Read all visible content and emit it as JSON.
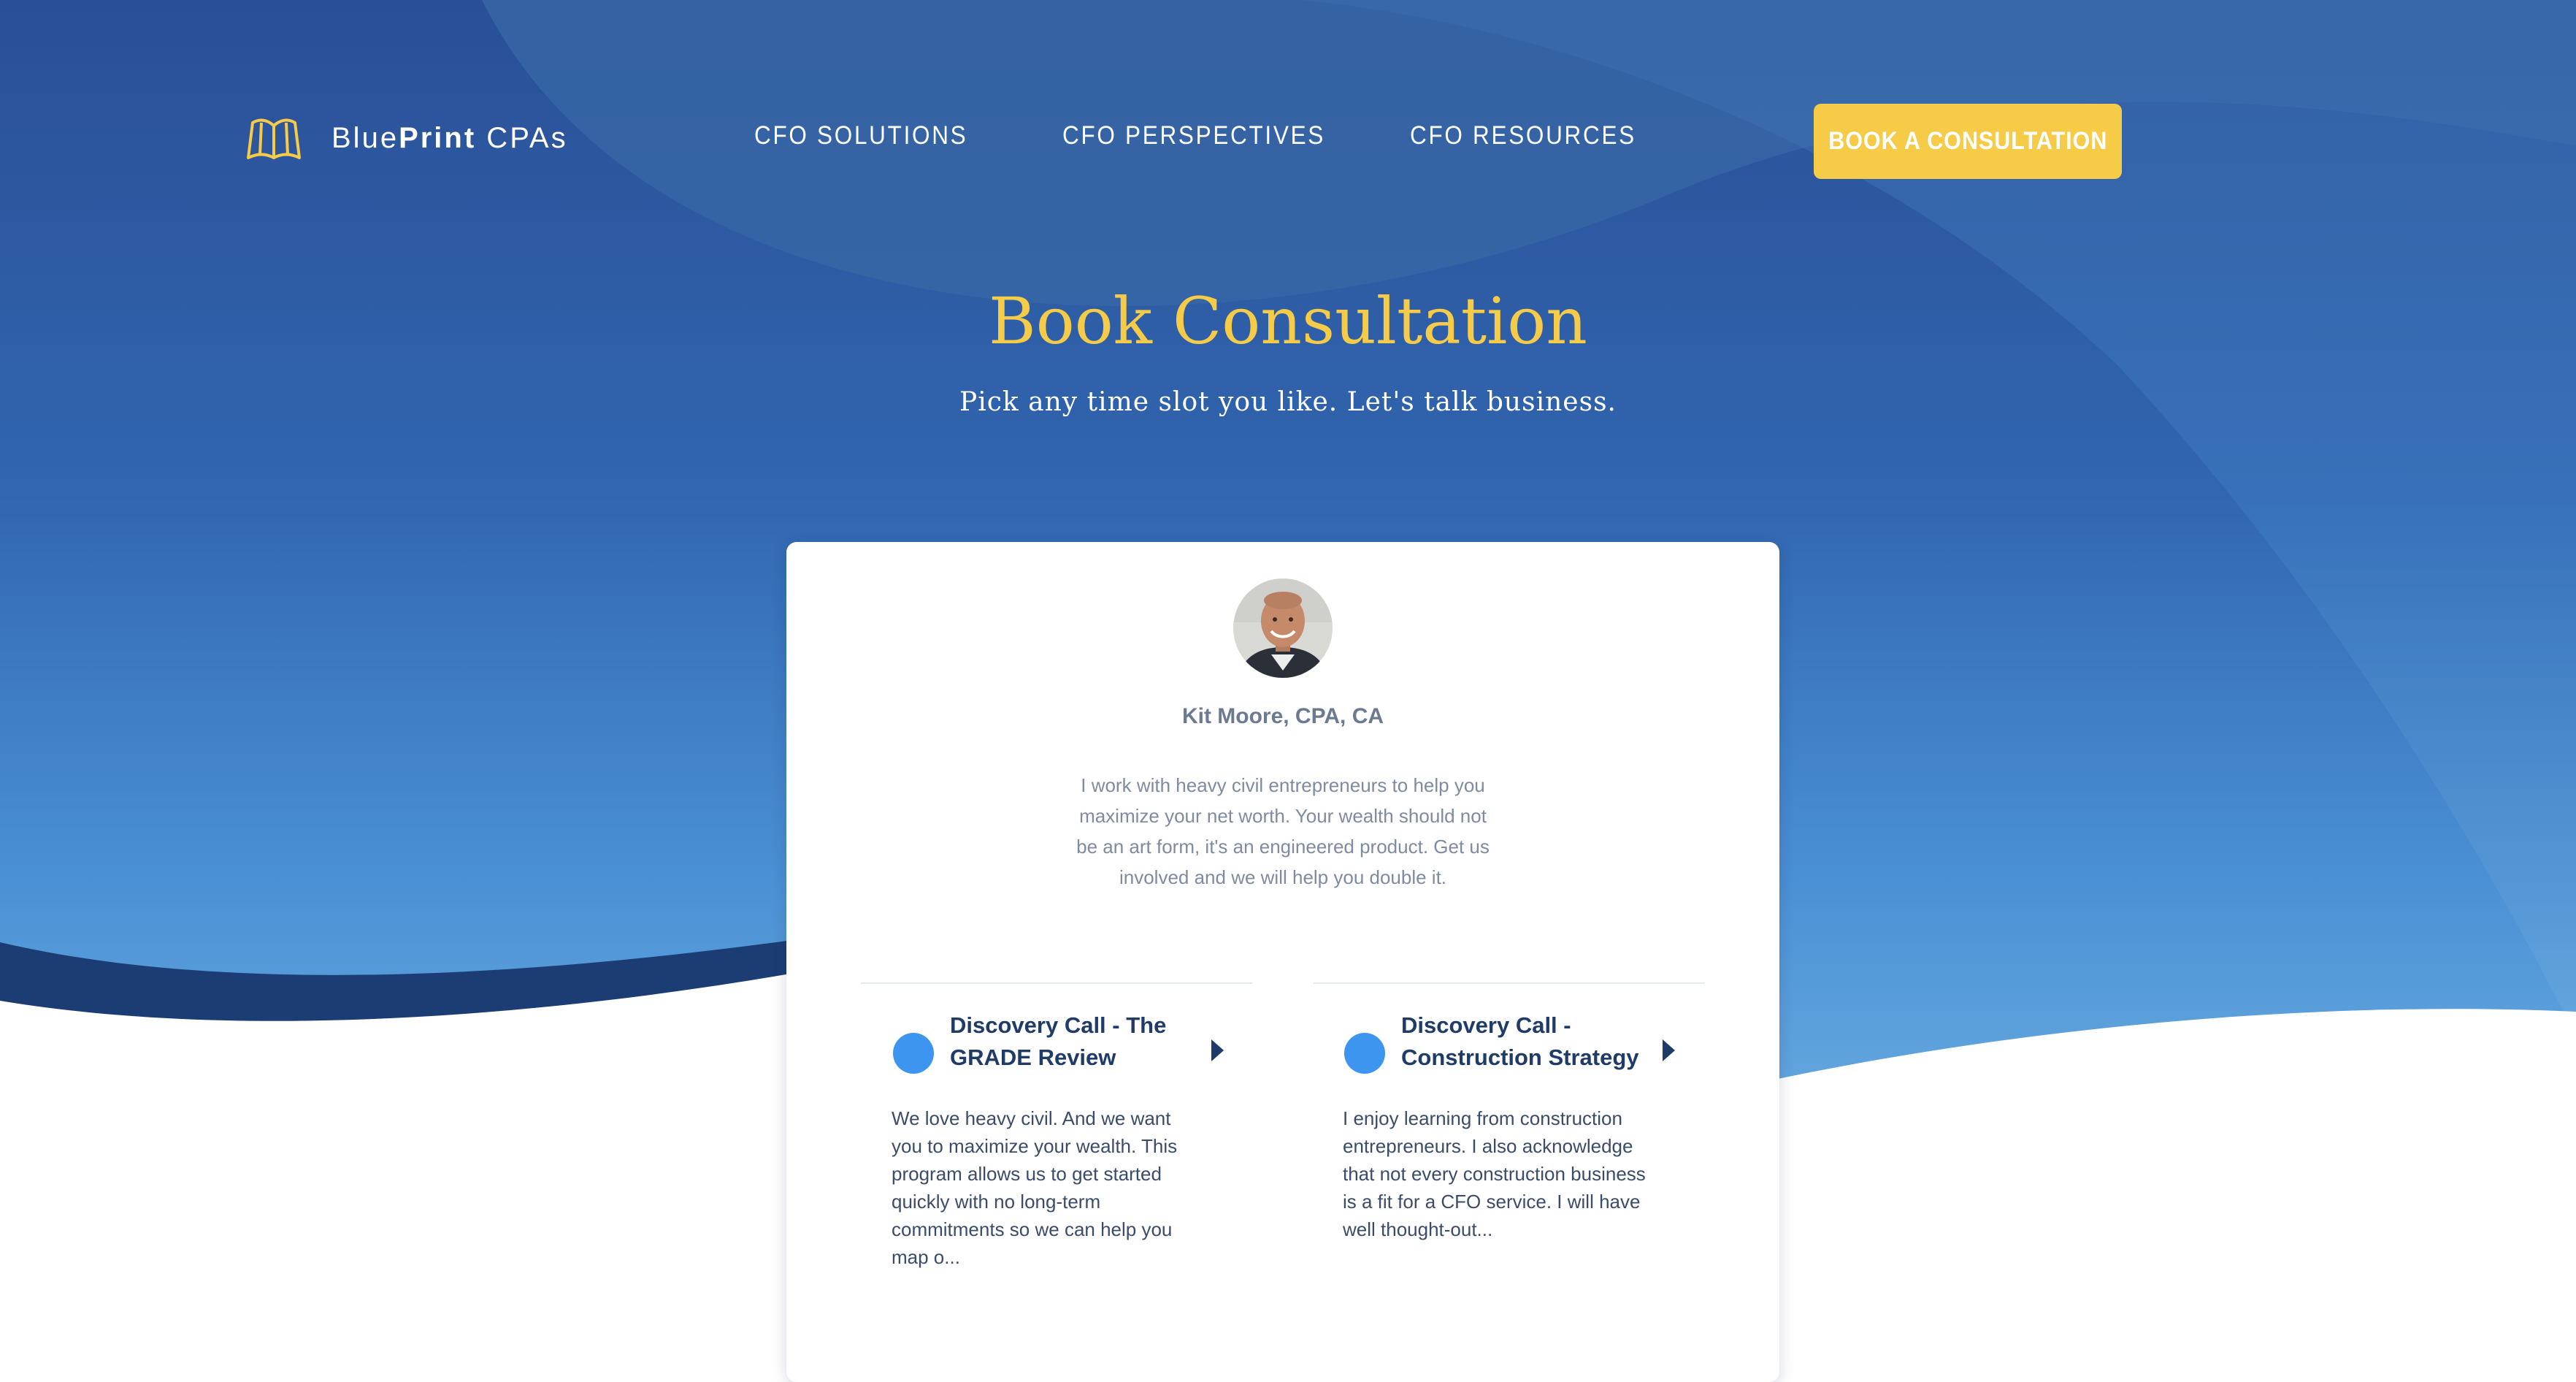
{
  "brand": {
    "name_part1": "Blue",
    "name_part2": "Print",
    "name_part3": " CPAs",
    "logo_icon": "open-book-icon"
  },
  "nav": {
    "links": [
      "CFO SOLUTIONS",
      "CFO PERSPECTIVES",
      "CFO RESOURCES"
    ],
    "cta_label": "BOOK A CONSULTATION"
  },
  "hero": {
    "title": "Book Consultation",
    "subtitle": "Pick any time slot you like. Let's talk business."
  },
  "host": {
    "name": "Kit Moore, CPA, CA",
    "bio": "I work with heavy civil entrepreneurs to help you maximize your net worth.   Your wealth should not be an art form, it's an engineered product. Get us involved and we will help you double it."
  },
  "events": [
    {
      "title_line1": "Discovery Call - The",
      "title_line2": "GRADE Review",
      "desc_lines": [
        "We love heavy civil. And we want",
        "you to maximize your wealth. This",
        "program allows us to get started",
        "quickly with no long-term",
        "commitments so we can help you",
        "map o..."
      ]
    },
    {
      "title_line1": "Discovery Call -",
      "title_line2": "Construction Strategy",
      "desc_lines": [
        "I enjoy learning from construction",
        "entrepreneurs. I also acknowledge",
        "that not every construction business",
        "is a fit for a CFO service. I will have",
        "well thought-out..."
      ]
    }
  ],
  "colors": {
    "accent_yellow": "#f6cb47",
    "navy": "#1f3b68",
    "event_dot": "#3d95f0",
    "hero_top": "#2b539b",
    "hero_bottom": "#5aa2dc"
  }
}
